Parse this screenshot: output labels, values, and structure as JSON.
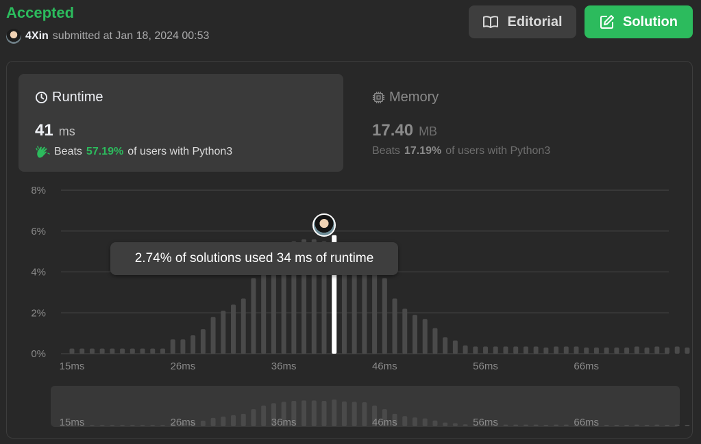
{
  "header": {
    "status": "Accepted",
    "user": "4Xin",
    "submitted_text": "submitted at Jan 18, 2024 00:53",
    "editorial_label": "Editorial",
    "solution_label": "Solution"
  },
  "runtime": {
    "title": "Runtime",
    "value": "41",
    "unit": "ms",
    "beats_label": "Beats",
    "beats_pct": "57.19%",
    "beats_suffix": "of users with Python3"
  },
  "memory": {
    "title": "Memory",
    "value": "17.40",
    "unit": "MB",
    "beats_label": "Beats",
    "beats_pct": "17.19%",
    "beats_suffix": "of users with Python3"
  },
  "tooltip": {
    "text": "2.74% of solutions used 34 ms of runtime"
  },
  "colors": {
    "accent_green": "#2cbb5d",
    "bar": "#4a4a4a",
    "highlight_bar": "#ffffff"
  },
  "chart_data": {
    "type": "bar",
    "y_ticks": [
      "0%",
      "2%",
      "4%",
      "6%",
      "8%"
    ],
    "ylim": [
      0,
      8
    ],
    "x_ticks": [
      "15ms",
      "26ms",
      "36ms",
      "46ms",
      "56ms",
      "66ms"
    ],
    "categories": [
      15,
      16,
      17,
      18,
      19,
      20,
      21,
      22,
      23,
      24,
      25,
      26,
      27,
      28,
      29,
      30,
      31,
      32,
      33,
      34,
      35,
      36,
      37,
      38,
      39,
      40,
      41,
      42,
      43,
      44,
      45,
      46,
      47,
      48,
      49,
      50,
      51,
      52,
      53,
      54,
      55,
      56,
      57,
      58,
      59,
      60,
      61,
      62,
      63,
      64,
      65,
      66,
      67,
      68,
      69,
      70,
      71,
      72,
      73,
      74,
      75,
      76
    ],
    "values": [
      0.25,
      0.25,
      0.25,
      0.25,
      0.25,
      0.25,
      0.25,
      0.25,
      0.25,
      0.25,
      0.7,
      0.7,
      0.9,
      1.2,
      1.8,
      2.1,
      2.4,
      2.7,
      3.7,
      4.5,
      5.0,
      5.3,
      5.5,
      5.6,
      5.6,
      5.5,
      5.8,
      5.4,
      5.3,
      5.2,
      4.5,
      3.7,
      2.7,
      2.2,
      1.9,
      1.7,
      1.25,
      0.8,
      0.65,
      0.4,
      0.35,
      0.35,
      0.35,
      0.35,
      0.35,
      0.35,
      0.35,
      0.3,
      0.35,
      0.35,
      0.35,
      0.3,
      0.3,
      0.3,
      0.3,
      0.3,
      0.35,
      0.3,
      0.35,
      0.3,
      0.35,
      0.3
    ],
    "highlight_category": 41,
    "grid": true
  }
}
